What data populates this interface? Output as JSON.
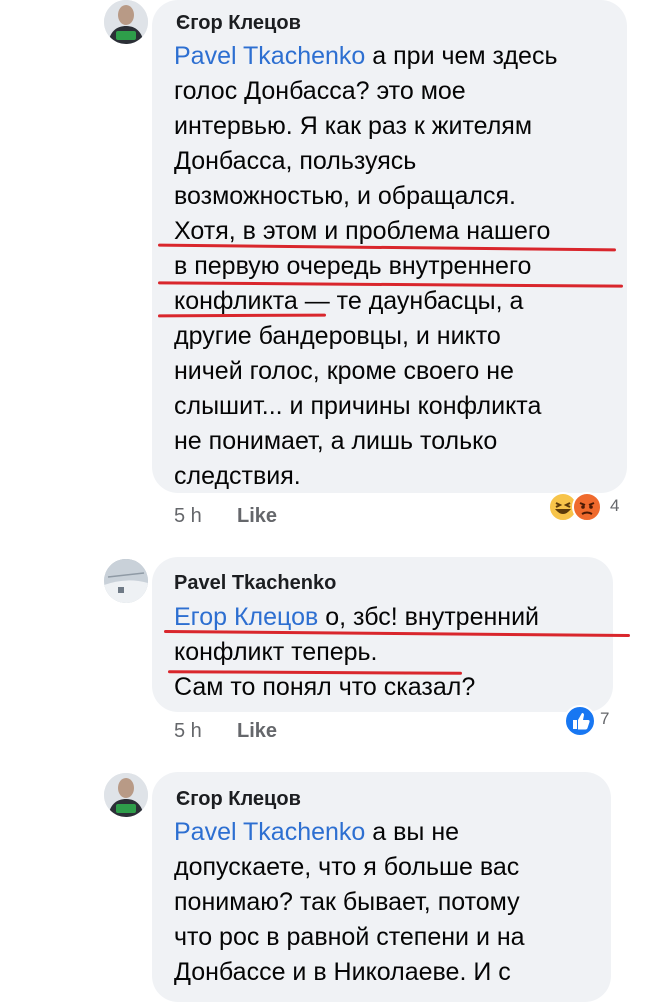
{
  "comments": [
    {
      "author": "Єгор Клецов",
      "mention": "Pavel Tkachenko",
      "lines": [
        " а при чем здесь",
        "голос Донбасса? это мое",
        "интервью. Я как раз к жителям",
        "Донбасса, пользуясь",
        "возможностью, и обращался.",
        "Хотя, в этом и проблема нашего",
        "в первую очередь внутреннего",
        "конфликта — те даунбасцы, а",
        "другие бандеровцы, и никто",
        "ничей голос, кроме своего не",
        "слышит... и причины конфликта",
        "не понимает, а лишь только",
        "следствия."
      ],
      "time": "5 h",
      "like": "Like",
      "reactions": [
        "laugh",
        "angry"
      ],
      "reaction_count": "4"
    },
    {
      "author": "Pavel Tkachenko",
      "mention": "Егор Клецов",
      "lines": [
        " о, збс! внутренний",
        "конфликт теперь.",
        "Сам то понял что сказал?"
      ],
      "time": "5 h",
      "like": "Like",
      "reactions": [
        "like"
      ],
      "reaction_count": "7"
    },
    {
      "author": "Єгор Клецов",
      "mention": "Pavel Tkachenko",
      "lines": [
        " а вы не",
        "допускаете, что я больше вас",
        "понимаю? так бывает, потому",
        "что рос в равной степени и на",
        "Донбассе и в Николаеве. И с"
      ]
    }
  ],
  "colors": {
    "mention": "#2d6fd1",
    "bubble": "#f0f2f5",
    "underline": "#d9262c",
    "meta": "#65676b"
  }
}
